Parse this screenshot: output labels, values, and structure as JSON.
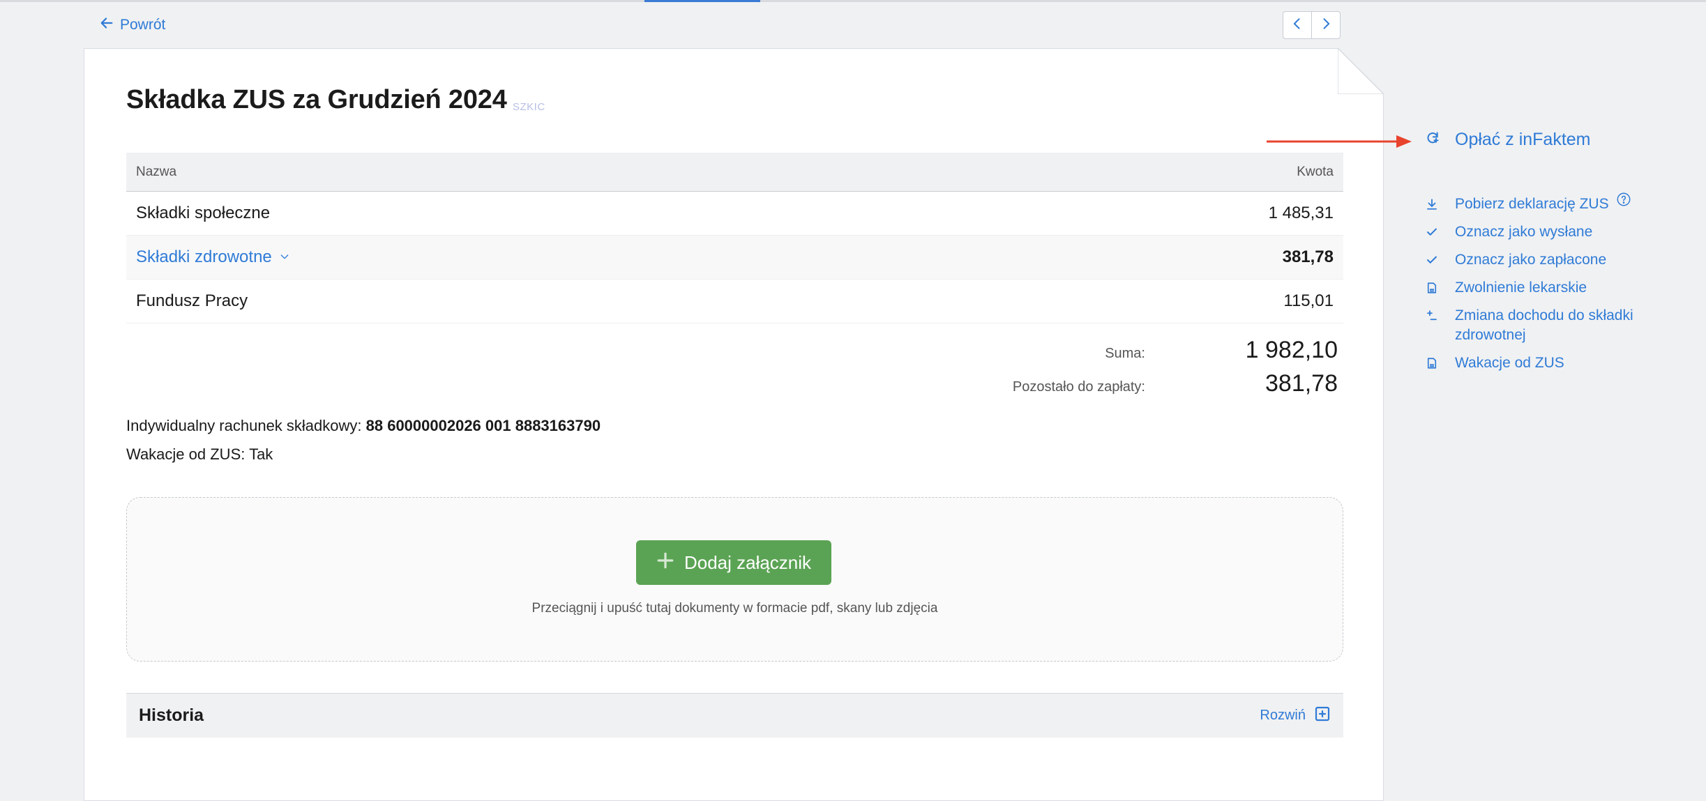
{
  "nav": {
    "back_label": "Powrót",
    "prev_icon": "chevron-left-icon",
    "next_icon": "chevron-right-icon"
  },
  "document": {
    "title": "Składka ZUS za Grudzień 2024",
    "status": "SZKIC"
  },
  "table": {
    "headers": {
      "name": "Nazwa",
      "amount": "Kwota"
    },
    "rows": [
      {
        "name": "Składki społeczne",
        "amount": "1 485,31"
      },
      {
        "name": "Składki zdrowotne",
        "amount": "381,78"
      },
      {
        "name": "Fundusz Pracy",
        "amount": "115,01"
      }
    ]
  },
  "totals": {
    "sum_label": "Suma:",
    "sum_value": "1 982,10",
    "remaining_label": "Pozostało do zapłaty:",
    "remaining_value": "381,78"
  },
  "info": {
    "account_label": "Indywidualny rachunek składkowy: ",
    "account_number": "88 60000002026 001 8883163790",
    "wakacje": "Wakacje od ZUS: Tak"
  },
  "attachments": {
    "button_label": "Dodaj załącznik",
    "hint": "Przeciągnij i upuść tutaj dokumenty w formacie pdf, skany lub zdjęcia"
  },
  "history": {
    "title": "Historia",
    "expand_label": "Rozwiń"
  },
  "sidebar": {
    "primary_action": "Opłać z inFaktem",
    "actions": [
      {
        "label": "Pobierz deklarację ZUS",
        "icon": "download-icon"
      },
      {
        "label": "Oznacz jako wysłane",
        "icon": "check-icon"
      },
      {
        "label": "Oznacz jako zapłacone",
        "icon": "check-icon"
      },
      {
        "label": "Zwolnienie lekarskie",
        "icon": "document-icon"
      },
      {
        "label": "Zmiana dochodu do składki zdrowotnej",
        "icon": "plus-minus-icon"
      },
      {
        "label": "Wakacje od ZUS",
        "icon": "document-icon"
      }
    ]
  },
  "colors": {
    "link": "#2f7bd6",
    "primary_button": "#5ba354",
    "annotation_arrow": "#e8432d",
    "status_badge": "#b8bfe6"
  }
}
